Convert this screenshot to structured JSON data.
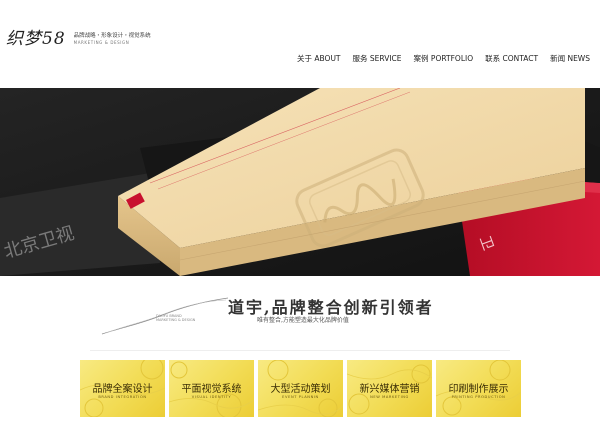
{
  "logo": {
    "mark": "织梦58",
    "line1": "品牌战略・形象设计・视觉系统",
    "line2": "MARKETING & DESIGN"
  },
  "nav": {
    "items": [
      {
        "label": "关于 ABOUT"
      },
      {
        "label": "服务 SERVICE"
      },
      {
        "label": "案例 PORTFOLIO"
      },
      {
        "label": "联系 CONTACT"
      },
      {
        "label": "新闻 NEWS"
      }
    ]
  },
  "hero": {
    "logo_text": "北京卫视"
  },
  "slogan": {
    "title": "道宇,品牌整合创新引领者",
    "subtitle": "唯有整合,方能塑造最大化品牌价值",
    "tiny_line1": "DAOYU BRAND",
    "tiny_line2": "MARKETING & DESIGN"
  },
  "tiles": [
    {
      "title": "品牌全案设计",
      "en": "BRAND INTEGRATION"
    },
    {
      "title": "平面视觉系统",
      "en": "VISUAL IDENTITY"
    },
    {
      "title": "大型活动策划",
      "en": "EVENT PLANNIN"
    },
    {
      "title": "新兴媒体营销",
      "en": "NEW MARKETING"
    },
    {
      "title": "印刷制作展示",
      "en": "PRINTING PRODUCTION"
    }
  ],
  "colors": {
    "tile_yellow": "#f2dc55",
    "hero_bg": "#1c1c1c",
    "box_cream": "#f0d7a4",
    "accent_red": "#c8102e"
  }
}
